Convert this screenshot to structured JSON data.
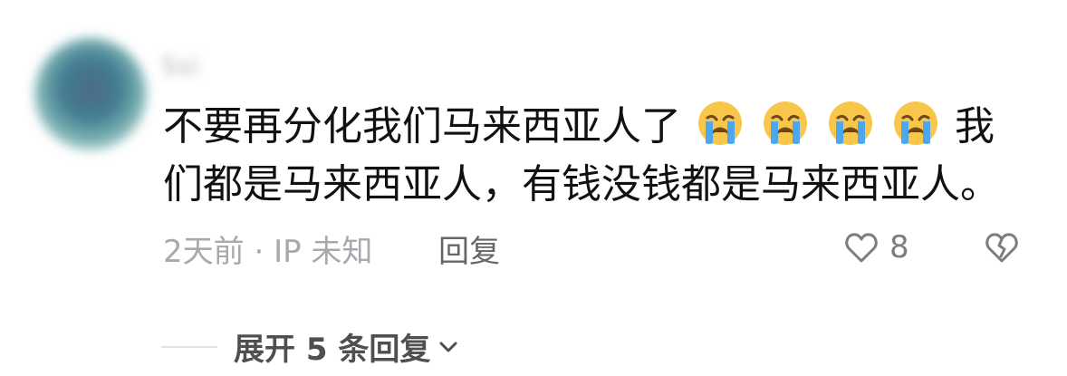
{
  "comment": {
    "username": "Ssi",
    "text_before_emoji": "不要再分化我们马来西亚人了",
    "emojis": [
      "crying-face",
      "crying-face",
      "crying-face",
      "crying-face"
    ],
    "text_after_emoji": "我们都是马来西亚人，有钱没钱都是马来西亚人。",
    "time": "2天前",
    "separator": "·",
    "ip": "IP 未知",
    "reply_label": "回复",
    "like_count": "8"
  },
  "replies": {
    "expand_label": "展开 5 条回复"
  },
  "colors": {
    "text": "#111111",
    "meta": "#a9a9ad",
    "reply": "#666666",
    "emoji_face": "#f7c64b",
    "emoji_tears": "#42a5f5"
  }
}
